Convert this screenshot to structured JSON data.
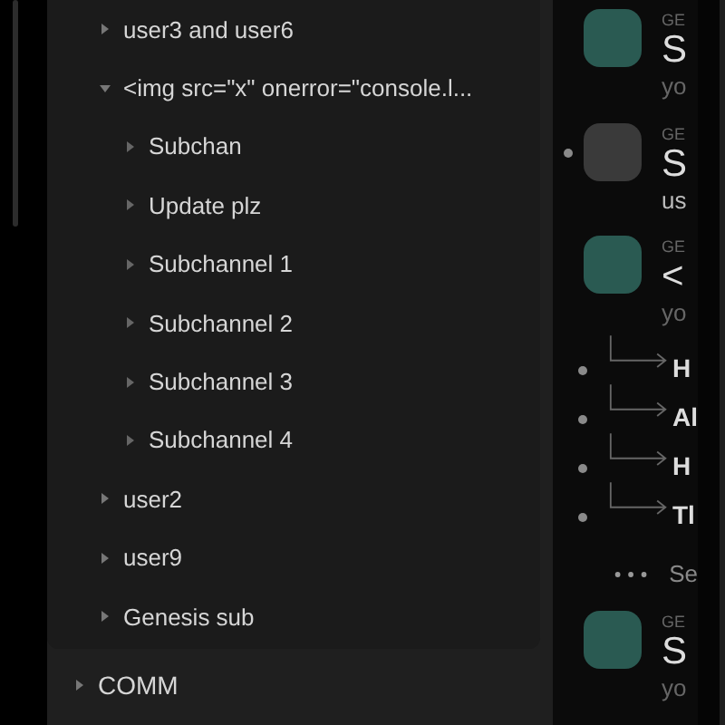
{
  "tree": [
    {
      "label": "user3 and user6",
      "expanded": false
    },
    {
      "label": "<img src=\"x\" onerror=\"console.l...",
      "expanded": true,
      "children": [
        {
          "label": "Subchan",
          "expanded": false
        },
        {
          "label": "Update plz",
          "expanded": false
        },
        {
          "label": "Subchannel 1",
          "expanded": false
        },
        {
          "label": "Subchannel 2",
          "expanded": false
        },
        {
          "label": "Subchannel 3",
          "expanded": false
        },
        {
          "label": "Subchannel 4",
          "expanded": false
        }
      ]
    },
    {
      "label": "user2",
      "expanded": false
    },
    {
      "label": "user9",
      "expanded": false
    },
    {
      "label": "Genesis sub",
      "expanded": false
    }
  ],
  "section": {
    "label": "COMM",
    "expanded": false
  },
  "feed": [
    {
      "kind": "message",
      "color": "#2a5a52",
      "unread": false,
      "channel": "GE",
      "title": "S",
      "snippet": "yo"
    },
    {
      "kind": "message",
      "color": "#3a3a3a",
      "unread": true,
      "channel": "GE",
      "title": "S",
      "snippet": "us"
    },
    {
      "kind": "message",
      "color": "#2a5a52",
      "unread": false,
      "channel": "GE",
      "title": "<",
      "snippet": "yo"
    },
    {
      "kind": "reply",
      "unread": true,
      "text": "H"
    },
    {
      "kind": "reply",
      "unread": true,
      "text": "Al"
    },
    {
      "kind": "reply",
      "unread": true,
      "text": "H"
    },
    {
      "kind": "reply",
      "unread": true,
      "text": "Tl"
    },
    {
      "kind": "more",
      "text": "Se"
    },
    {
      "kind": "message",
      "color": "#2a5a52",
      "unread": false,
      "channel": "GE",
      "title": "S",
      "snippet": "yo"
    }
  ]
}
